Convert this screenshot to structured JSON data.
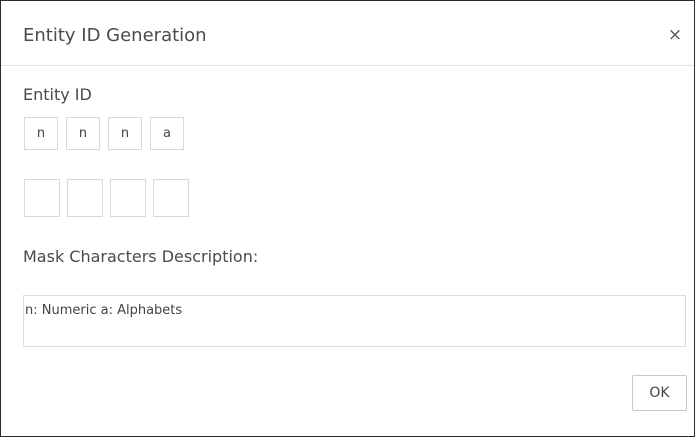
{
  "dialog": {
    "title": "Entity ID Generation",
    "close_icon": "close-icon",
    "close_glyph": "×"
  },
  "entity_id": {
    "label": "Entity ID",
    "mask": [
      "n",
      "n",
      "n",
      "a"
    ],
    "inputs": [
      "",
      "",
      "",
      ""
    ]
  },
  "mask_description": {
    "label": "Mask Characters Description:",
    "text": "n: Numeric a: Alphabets"
  },
  "footer": {
    "ok_label": "OK"
  }
}
